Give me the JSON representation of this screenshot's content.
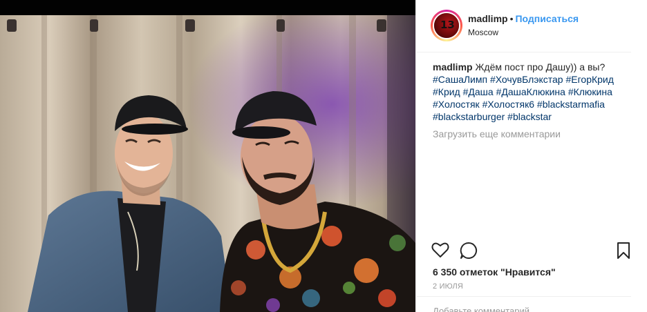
{
  "post": {
    "username": "madlimp",
    "separator": "•",
    "follow_label": "Подписаться",
    "location": "Moscow",
    "avatar_text": "13",
    "caption": {
      "text": "Ждём пост про Дашу)) а вы?",
      "hashtags": "#СашаЛимп #ХочувБлэкстар #ЕгорКрид #Крид #Даша #ДашаКлюкина #Клюкина #Холостяк #Холостяк6 #blackstarmafia #blackstarburger #blackstar"
    },
    "load_more_label": "Загрузить еще комментарии",
    "likes": "6 350 отметок \"Нравится\"",
    "date": "2 ИЮЛЯ",
    "comment_placeholder": "Добавьте комментарий..."
  },
  "icons": {
    "like": "heart-icon",
    "comment": "comment-icon",
    "save": "bookmark-icon"
  },
  "colors": {
    "link": "#3897f0",
    "hashtag": "#003569",
    "muted": "#999999",
    "divider": "#efefef"
  }
}
